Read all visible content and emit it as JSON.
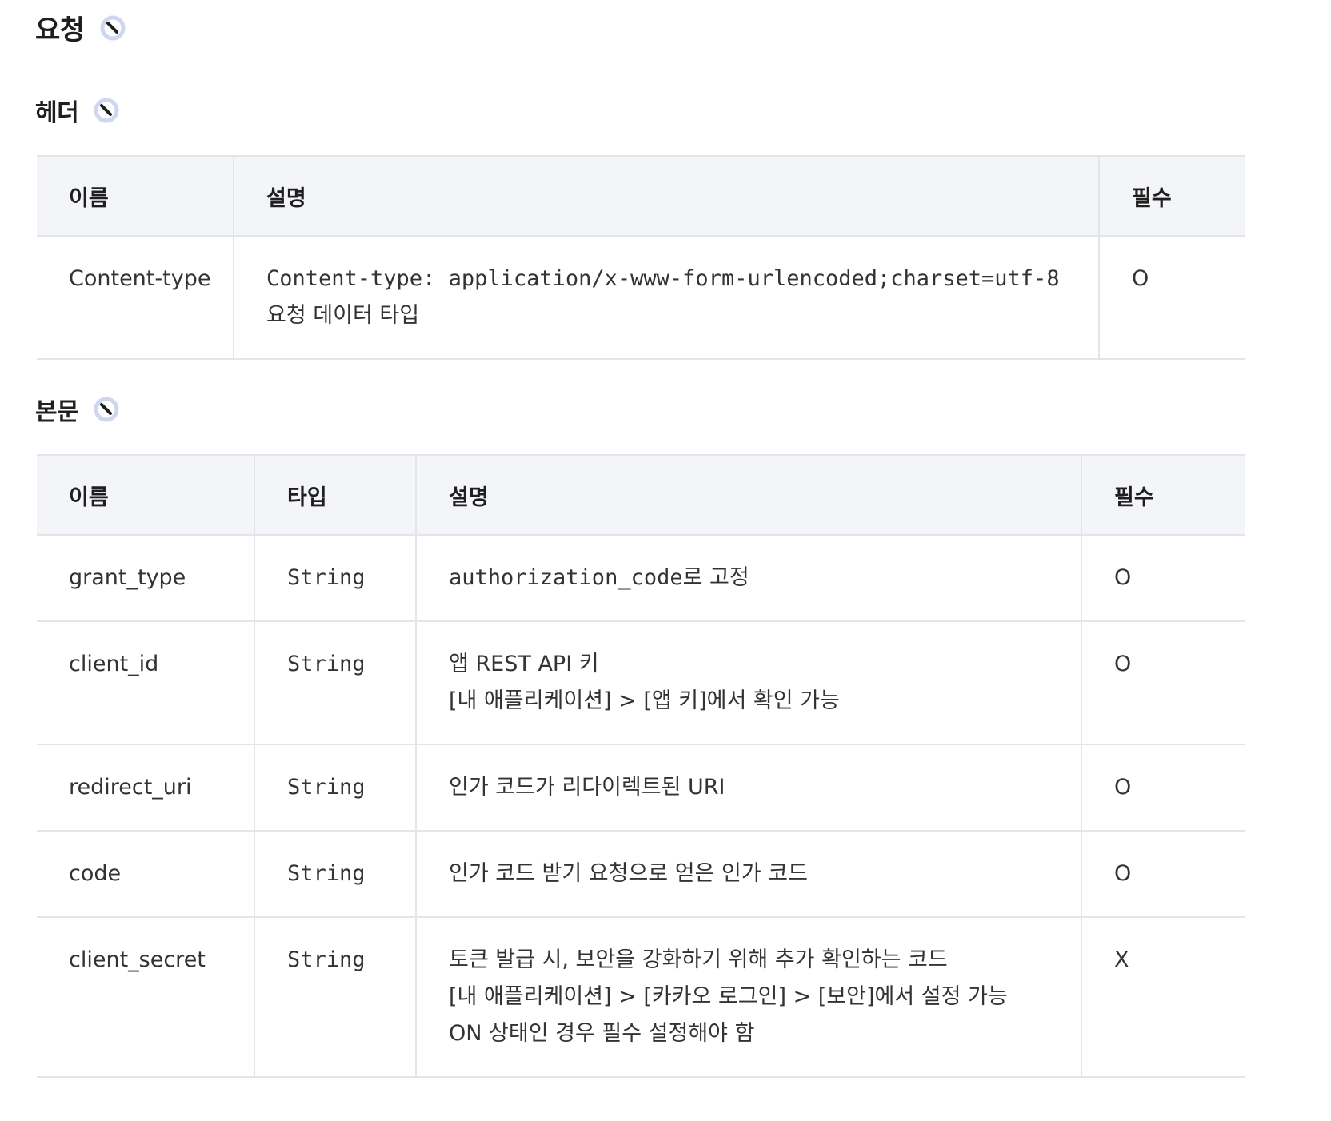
{
  "section": {
    "title": "요청",
    "icon": "link-icon"
  },
  "header_section": {
    "title": "헤더",
    "columns": [
      "이름",
      "설명",
      "필수"
    ],
    "rows": [
      {
        "name": "Content-type",
        "description_code": "Content-type: application/x-www-form-urlencoded;charset=utf-8",
        "description_text": "요청 데이터 타입",
        "required": "O"
      }
    ]
  },
  "body_section": {
    "title": "본문",
    "columns": [
      "이름",
      "타입",
      "설명",
      "필수"
    ],
    "rows": [
      {
        "name": "grant_type",
        "type": "String",
        "description_code": "authorization_code",
        "description_suffix": "로 고정",
        "required": "O"
      },
      {
        "name": "client_id",
        "type": "String",
        "description_lines": [
          "앱 REST API 키",
          "[내 애플리케이션] > [앱 키]에서 확인 가능"
        ],
        "required": "O"
      },
      {
        "name": "redirect_uri",
        "type": "String",
        "description_lines": [
          "인가 코드가 리다이렉트된 URI"
        ],
        "required": "O"
      },
      {
        "name": "code",
        "type": "String",
        "description_lines": [
          "인가 코드 받기 요청으로 얻은 인가 코드"
        ],
        "required": "O"
      },
      {
        "name": "client_secret",
        "type": "String",
        "description_lines": [
          "토큰 발급 시, 보안을 강화하기 위해 추가 확인하는 코드",
          "[내 애플리케이션] > [카카오 로그인] > [보안]에서 설정 가능",
          "ON 상태인 경우 필수 설정해야 함"
        ],
        "required": "X"
      }
    ]
  }
}
